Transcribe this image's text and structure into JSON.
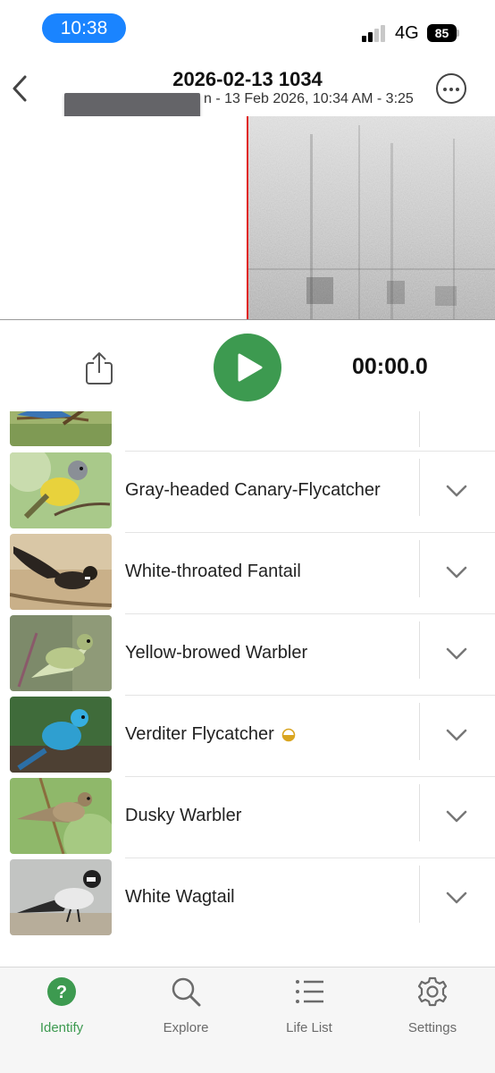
{
  "status_bar": {
    "time": "10:38",
    "network": "4G",
    "battery": "85"
  },
  "header": {
    "title": "2026-02-13 1034",
    "subtitle": "n - 13 Feb 2026, 10:34 AM - 3:25"
  },
  "player": {
    "timer": "00:00.0"
  },
  "species": [
    {
      "name": "",
      "thumb": "bluebird"
    },
    {
      "name": "Gray-headed Canary-Flycatcher",
      "thumb": "canary-flycatcher"
    },
    {
      "name": "White-throated Fantail",
      "thumb": "fantail"
    },
    {
      "name": "Yellow-browed Warbler",
      "thumb": "warbler"
    },
    {
      "name": "Verditer Flycatcher",
      "thumb": "verditer",
      "badge": "half-circle-icon"
    },
    {
      "name": "Dusky Warbler",
      "thumb": "dusky"
    },
    {
      "name": "White Wagtail",
      "thumb": "wagtail"
    }
  ],
  "tabs": [
    {
      "label": "Identify",
      "icon": "question-circle-icon",
      "active": true
    },
    {
      "label": "Explore",
      "icon": "search-icon",
      "active": false
    },
    {
      "label": "Life List",
      "icon": "list-icon",
      "active": false
    },
    {
      "label": "Settings",
      "icon": "gear-icon",
      "active": false
    }
  ],
  "colors": {
    "accent_green": "#3d9a50",
    "time_pill": "#1a84ff",
    "playhead": "#e0211c",
    "badge_gold": "#d9a520"
  }
}
